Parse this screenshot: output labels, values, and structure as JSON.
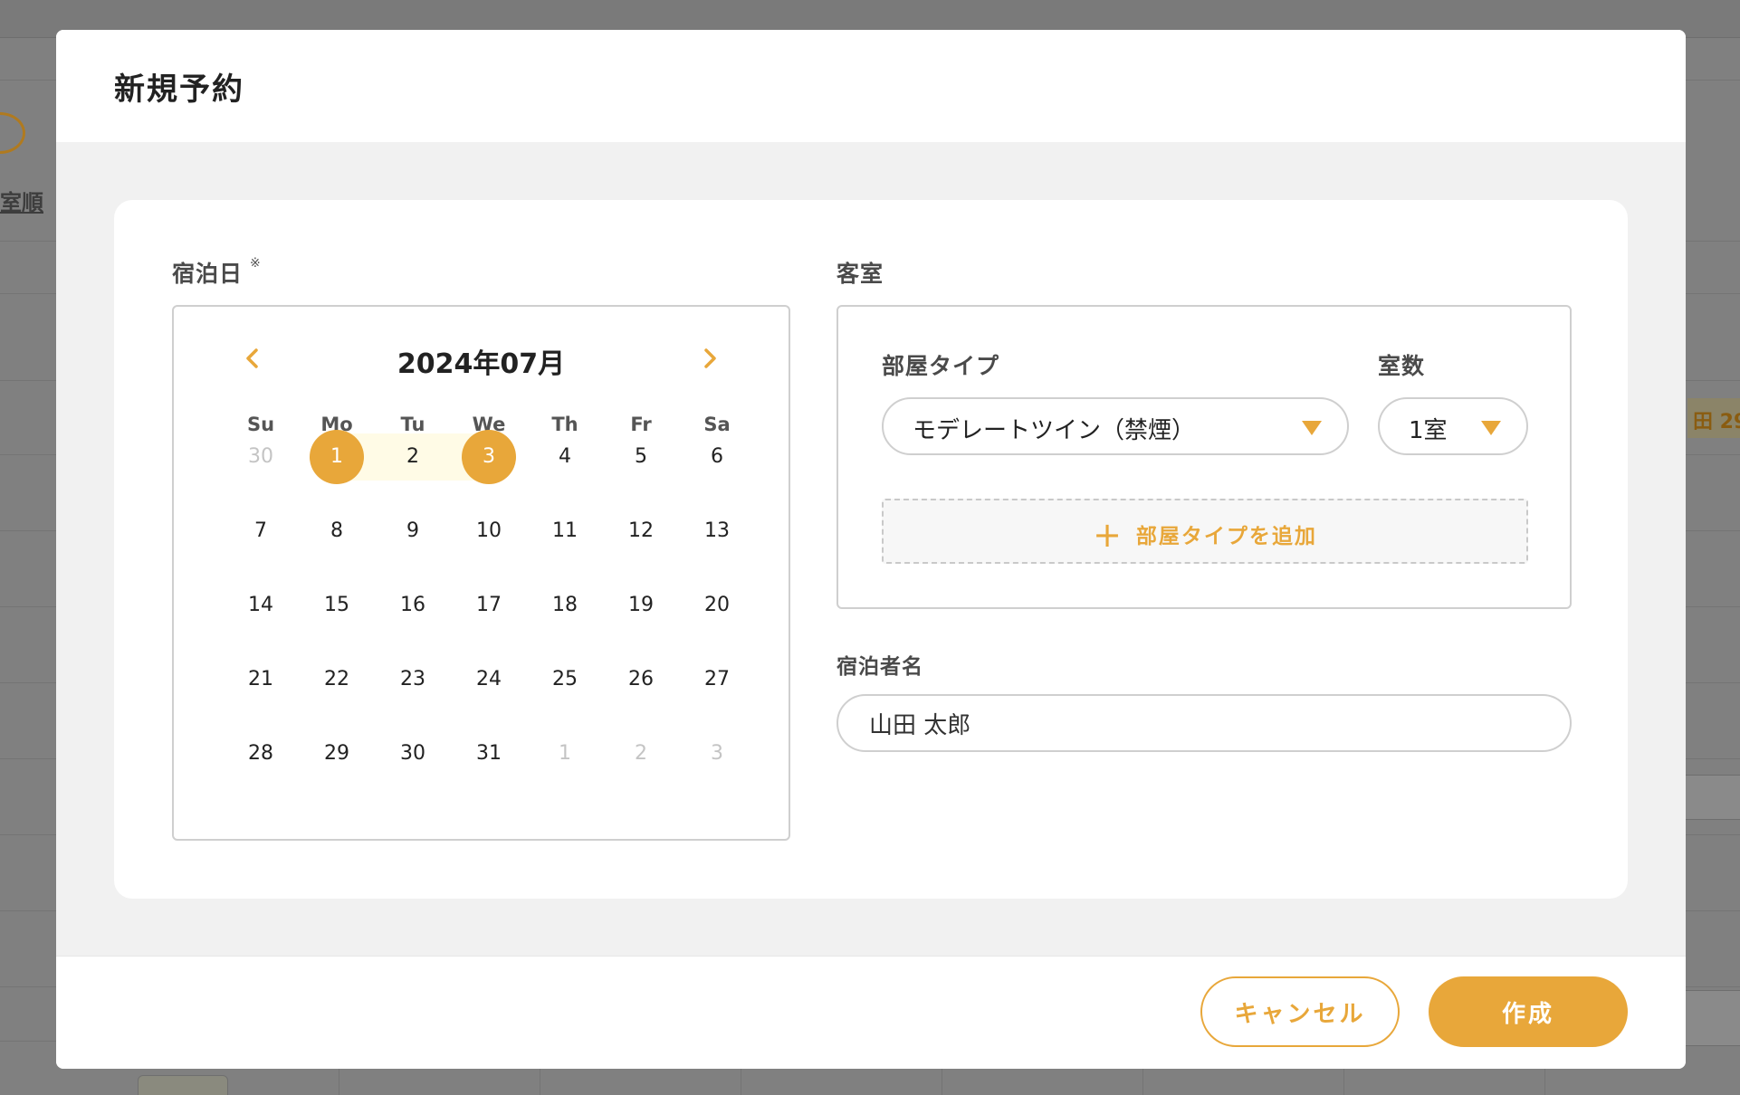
{
  "background": {
    "link_text": "室順",
    "chip_text": "田 29"
  },
  "modal": {
    "title": "新規予約",
    "stay_date_label": "宿泊日",
    "required_mark": "※",
    "room_section_label": "客室",
    "calendar": {
      "month_label": "2024年07月",
      "weekdays": [
        "Su",
        "Mo",
        "Tu",
        "We",
        "Th",
        "Fr",
        "Sa"
      ],
      "weeks": [
        [
          {
            "d": "30",
            "m": true
          },
          {
            "d": "1",
            "s": true
          },
          {
            "d": "2"
          },
          {
            "d": "3",
            "s": true
          },
          {
            "d": "4"
          },
          {
            "d": "5"
          },
          {
            "d": "6"
          }
        ],
        [
          {
            "d": "7"
          },
          {
            "d": "8"
          },
          {
            "d": "9"
          },
          {
            "d": "10"
          },
          {
            "d": "11"
          },
          {
            "d": "12"
          },
          {
            "d": "13"
          }
        ],
        [
          {
            "d": "14"
          },
          {
            "d": "15"
          },
          {
            "d": "16"
          },
          {
            "d": "17"
          },
          {
            "d": "18"
          },
          {
            "d": "19"
          },
          {
            "d": "20"
          }
        ],
        [
          {
            "d": "21"
          },
          {
            "d": "22"
          },
          {
            "d": "23"
          },
          {
            "d": "24"
          },
          {
            "d": "25"
          },
          {
            "d": "26"
          },
          {
            "d": "27"
          }
        ],
        [
          {
            "d": "28"
          },
          {
            "d": "29"
          },
          {
            "d": "30"
          },
          {
            "d": "31"
          },
          {
            "d": "1",
            "m": true
          },
          {
            "d": "2",
            "m": true
          },
          {
            "d": "3",
            "m": true
          }
        ]
      ],
      "accent_color": "#e8a73a",
      "range_color": "#fffbe6"
    },
    "room": {
      "type_label": "部屋タイプ",
      "type_value": "モデレートツイン（禁煙）",
      "count_label": "室数",
      "count_value": "1室",
      "add_label": "部屋タイプを追加"
    },
    "guest": {
      "label": "宿泊者名",
      "value": "山田 太郎"
    },
    "buttons": {
      "cancel": "キャンセル",
      "create": "作成"
    }
  }
}
